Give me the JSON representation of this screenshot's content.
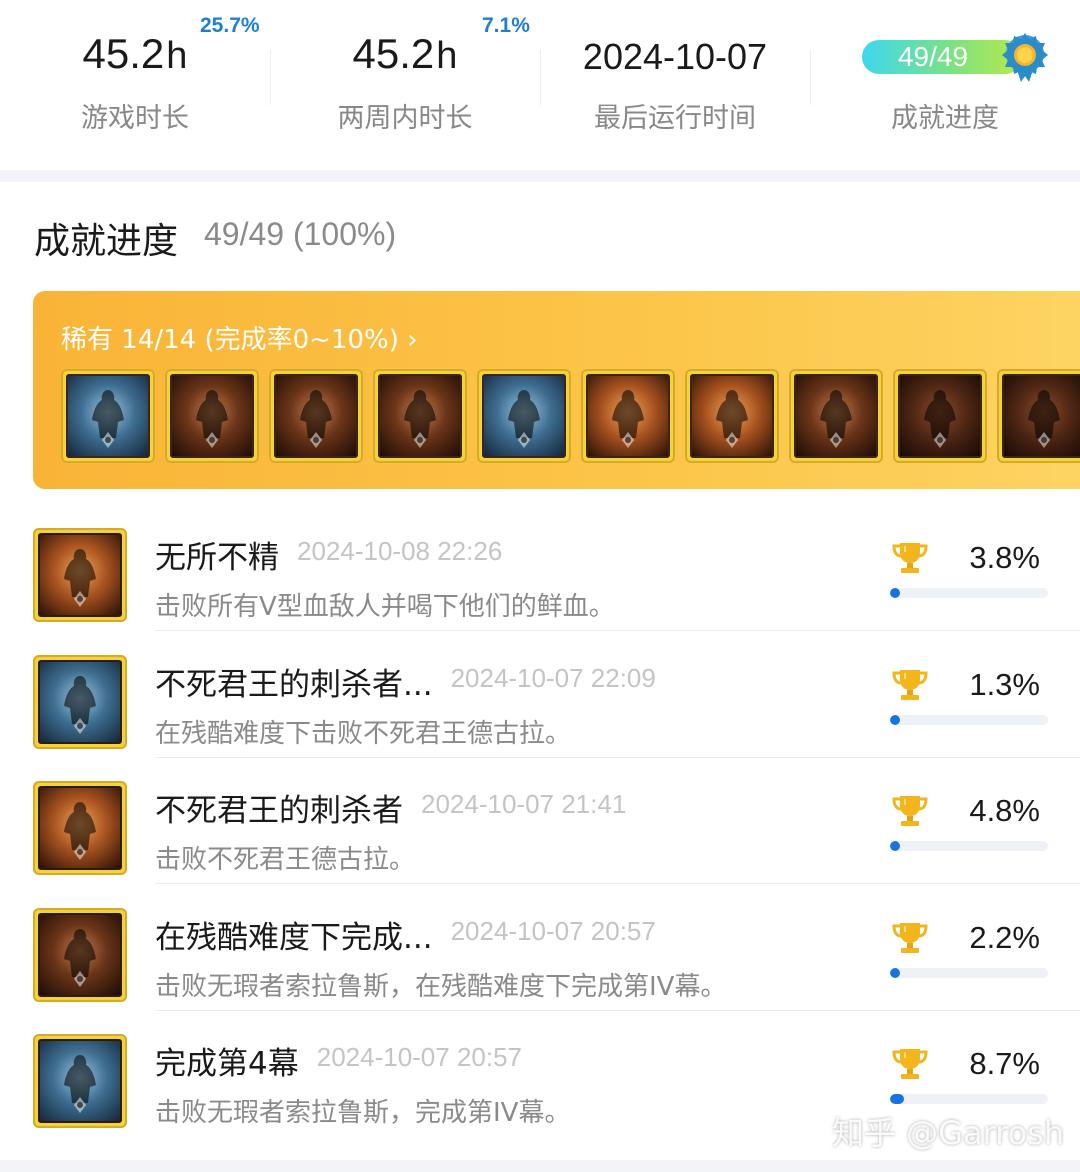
{
  "stats": {
    "play_time": {
      "value": "45.2",
      "unit": "h",
      "label": "游戏时长",
      "badge": "25.7%"
    },
    "two_week_time": {
      "value": "45.2",
      "unit": "h",
      "label": "两周内时长",
      "badge": "7.1%"
    },
    "last_run": {
      "value": "2024-10-07",
      "label": "最后运行时间"
    },
    "achievement": {
      "value": "49/49",
      "label": "成就进度"
    }
  },
  "section": {
    "title": "成就进度",
    "count": "49/49 (100%)"
  },
  "rare": {
    "title": "稀有 14/14 (完成率0~10%) ›",
    "icons": [
      {
        "name": "undead-king-icon",
        "tone": "blue"
      },
      {
        "name": "dark-warrior-icon",
        "tone": "brown"
      },
      {
        "name": "mage-icon",
        "tone": "brown"
      },
      {
        "name": "swordsman-icon",
        "tone": "brown"
      },
      {
        "name": "blood-bowl-icon",
        "tone": "blue"
      },
      {
        "name": "winged-figure-icon",
        "tone": "orange"
      },
      {
        "name": "armored-lord-icon",
        "tone": "orange"
      },
      {
        "name": "brute-icon",
        "tone": "brown"
      },
      {
        "name": "scythe-icon",
        "tone": "dark"
      },
      {
        "name": "mushroom-icon",
        "tone": "dark"
      }
    ]
  },
  "achievements": [
    {
      "name": "无所不精",
      "time": "2024-10-08 22:26",
      "desc": "击败所有V型血敌人并喝下他们的鲜血。",
      "percent_label": "3.8%",
      "percent": 3.8,
      "icon": "winged-figure-icon",
      "tone": "orange"
    },
    {
      "name": "不死君王的刺杀者...",
      "time": "2024-10-07 22:09",
      "desc": "在残酷难度下击败不死君王德古拉。",
      "percent_label": "1.3%",
      "percent": 1.3,
      "icon": "undead-king-icon",
      "tone": "blue"
    },
    {
      "name": "不死君王的刺杀者",
      "time": "2024-10-07 21:41",
      "desc": "击败不死君王德古拉。",
      "percent_label": "4.8%",
      "percent": 4.8,
      "icon": "armored-lord-icon",
      "tone": "orange"
    },
    {
      "name": "在残酷难度下完成...",
      "time": "2024-10-07 20:57",
      "desc": "击败无瑕者索拉鲁斯，在残酷难度下完成第IV幕。",
      "percent_label": "2.2%",
      "percent": 2.2,
      "icon": "dark-warrior-icon",
      "tone": "brown"
    },
    {
      "name": "完成第4幕",
      "time": "2024-10-07 20:57",
      "desc": "击败无瑕者索拉鲁斯，完成第IV幕。",
      "percent_label": "8.7%",
      "percent": 8.7,
      "icon": "hero-silhouette-icon",
      "tone": "blue"
    }
  ],
  "watermark": "知乎 @Garrosh",
  "colors": {
    "accent_blue": "#1673e0",
    "banner_orange": "#f9b437",
    "badge_blue": "#1e7fd6"
  }
}
